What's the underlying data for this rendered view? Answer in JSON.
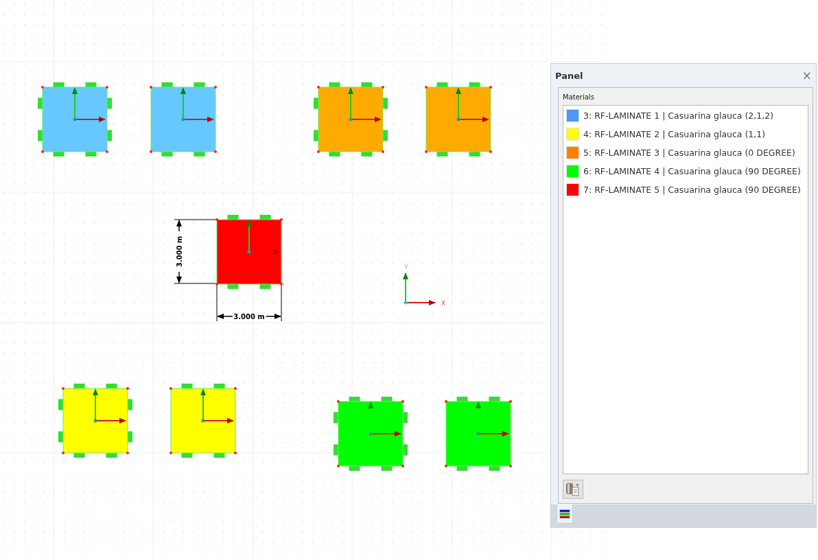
{
  "canvas": {
    "surfaces": [
      {
        "color": "#66c8fe",
        "side_supports": true,
        "x_axis_shown": true,
        "y_axis_shown": true
      },
      {
        "color": "#66c8fe",
        "side_supports": false,
        "x_axis_shown": true,
        "y_axis_shown": true
      },
      {
        "color": "#ffaa00",
        "side_supports": true,
        "x_axis_shown": true,
        "y_axis_shown": true
      },
      {
        "color": "#ffaa00",
        "side_supports": false,
        "x_axis_shown": true,
        "y_axis_shown": true
      },
      {
        "color": "#ff0000",
        "side_supports": false,
        "x_axis_shown": false,
        "y_axis_shown": true
      },
      {
        "color": "#ffff00",
        "side_supports": true,
        "x_axis_shown": true,
        "y_axis_shown": true
      },
      {
        "color": "#ffff00",
        "side_supports": false,
        "x_axis_shown": true,
        "y_axis_shown": true
      },
      {
        "color": "#00ff00",
        "side_supports": true,
        "x_axis_shown": true,
        "y_axis_shown": false
      },
      {
        "color": "#00ff00",
        "side_supports": false,
        "x_axis_shown": true,
        "y_axis_shown": false
      }
    ],
    "vertical_dimension": {
      "label": "3.000 m"
    },
    "horizontal_dimension": {
      "label": "3.000 m"
    },
    "global_axes": {
      "y_label": "Y",
      "x_label": "X"
    }
  },
  "panel": {
    "title": "Panel",
    "close": "×",
    "group_label": "Materials",
    "materials": [
      {
        "label": "3: RF-LAMINATE 1 | Casuarina glauca (2,1,2)",
        "color": "#4f97f0"
      },
      {
        "label": "4: RF-LAMINATE 2 | Casuarina glauca (1,1)",
        "color": "#ffff00"
      },
      {
        "label": "5: RF-LAMINATE 3 | Casuarina glauca (0 DEGREE)",
        "color": "#ff8000"
      },
      {
        "label": "6: RF-LAMINATE 4 | Casuarina glauca (90 DEGREE)",
        "color": "#00ff00"
      },
      {
        "label": "7: RF-LAMINATE 5 | Casuarina glauca (90 DEGREE)",
        "color": "#ff0000"
      }
    ]
  }
}
